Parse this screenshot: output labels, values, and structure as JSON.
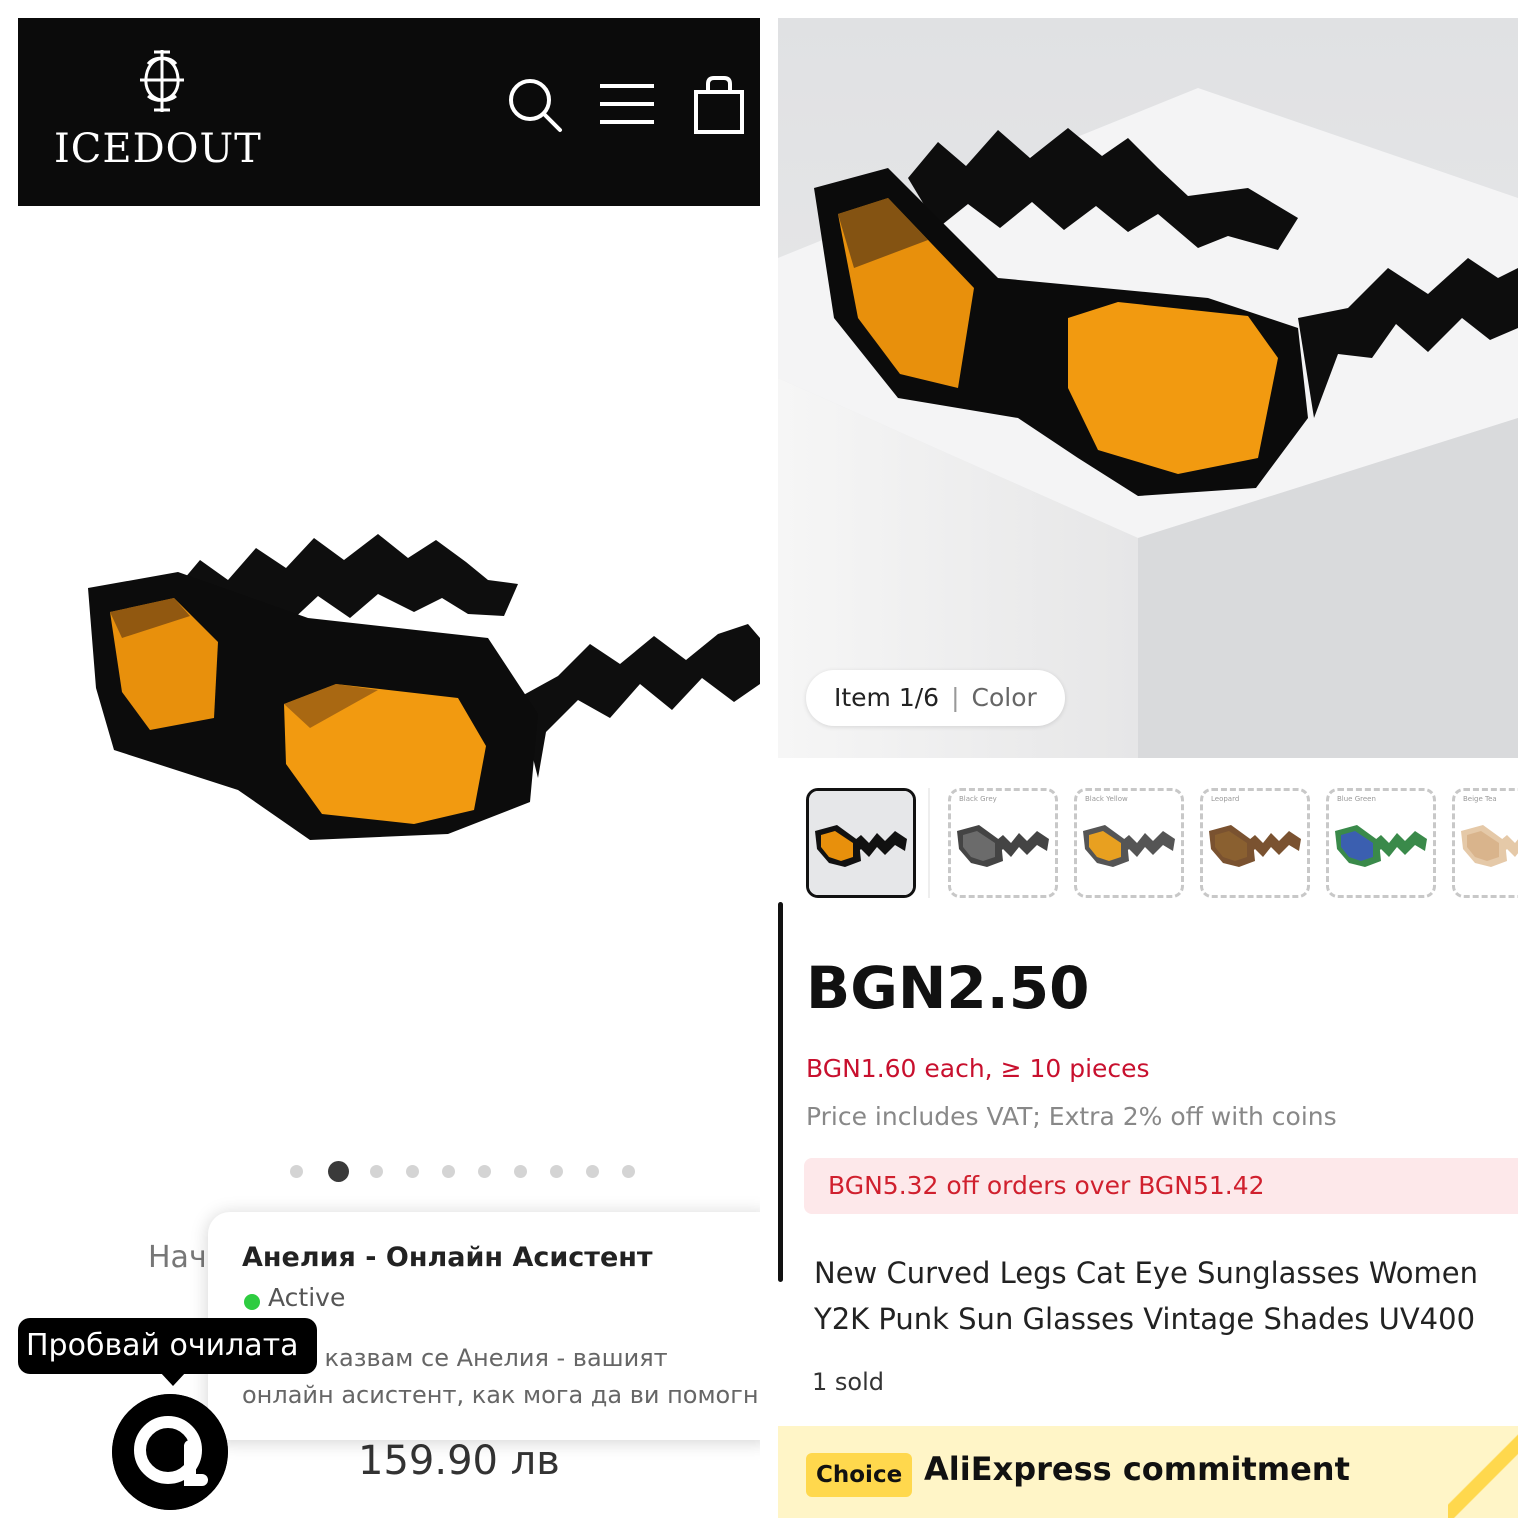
{
  "left_panel": {
    "brand": {
      "name": "ICEDOUT",
      "logo_icon": "crest-monogram-icon"
    },
    "header_icons": [
      "search-icon",
      "menu-icon",
      "shopping-bag-icon"
    ],
    "gallery": {
      "dot_count": 10,
      "active_index": 1
    },
    "breadcrumb_partial": "Нач",
    "chat": {
      "title": "Анелия - Онлайн Асистент",
      "status": "Active",
      "message_line1": "...йте, казвам се Анелия - вашият",
      "message_line2": "онлайн асистент, как мога да ви помогн"
    },
    "try_on_tooltip": "Пробвай очилата",
    "assistant_icon": "assistant-logo-icon",
    "price": "159.90 лв"
  },
  "right_panel": {
    "image_badge": {
      "counter": "Item 1/6",
      "separator": "|",
      "label": "Color"
    },
    "thumbnails": [
      {
        "label": "",
        "lens_color": "#e8900c",
        "frame_color": "#111111",
        "selected": true
      },
      {
        "label": "Black Grey",
        "lens_color": "#6b6b6b",
        "frame_color": "#444444",
        "selected": false
      },
      {
        "label": "Black Yellow",
        "lens_color": "#e8a020",
        "frame_color": "#555555",
        "selected": false
      },
      {
        "label": "Leopard",
        "lens_color": "#8a6030",
        "frame_color": "#7a5230",
        "selected": false
      },
      {
        "label": "Blue Green",
        "lens_color": "#3b5fb0",
        "frame_color": "#3a8a4a",
        "selected": false
      },
      {
        "label": "Beige Tea",
        "lens_color": "#d9b48c",
        "frame_color": "#e5c9a8",
        "selected": false
      }
    ],
    "price": "BGN2.50",
    "bulk_price": "BGN1.60 each, ≥ 10 pieces",
    "vat_note": "Price includes VAT; Extra 2% off with coins",
    "coupon": "BGN5.32 off orders over BGN51.42",
    "title_line1": "New Curved Legs Cat Eye Sunglasses Women",
    "title_line2": "Y2K Punk Sun Glasses Vintage Shades UV400",
    "sold": "1 sold",
    "choice_badge": "Choice",
    "choice_text": "AliExpress commitment"
  },
  "colors": {
    "header_bg": "#0b0b0b",
    "lens_orange": "#e8900c",
    "aliexpress_red": "#c8102e",
    "coupon_bg": "#fde8ea",
    "choice_yellow": "#ffd84d"
  }
}
